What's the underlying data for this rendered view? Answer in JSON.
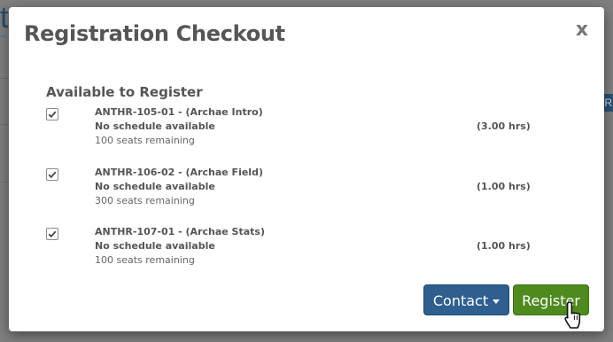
{
  "background": {
    "fragment_text": "t",
    "chip_text": "R"
  },
  "modal": {
    "title": "Registration Checkout",
    "close_label": "x",
    "section_heading": "Available to Register",
    "courses": [
      {
        "checked": true,
        "code": "ANTHR-105-01 - (Archae Intro)",
        "schedule": "No schedule available",
        "seats": "100 seats remaining",
        "hours": "(3.00 hrs)"
      },
      {
        "checked": true,
        "code": "ANTHR-106-02 - (Archae Field)",
        "schedule": "No schedule available",
        "seats": "300 seats remaining",
        "hours": "(1.00 hrs)"
      },
      {
        "checked": true,
        "code": "ANTHR-107-01 - (Archae Stats)",
        "schedule": "No schedule available",
        "seats": "100 seats remaining",
        "hours": "(1.00 hrs)"
      }
    ],
    "buttons": {
      "contact_label": "Contact",
      "register_label": "Register"
    }
  },
  "colors": {
    "contact_button": "#2e5f8e",
    "register_button": "#4e8a1e",
    "backdrop": "#7f7f7f"
  },
  "icons": {
    "checkbox": "checkmark-icon",
    "contact_caret": "caret-down-icon",
    "cursor": "hand-pointer-icon"
  }
}
